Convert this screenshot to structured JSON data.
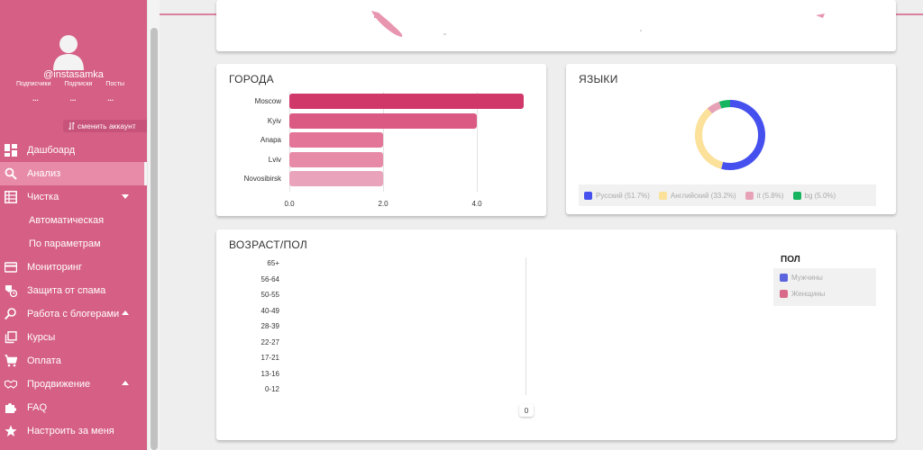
{
  "profile": {
    "username": "@instasamka",
    "stat_labels": [
      "Подписчики",
      "Подписки",
      "Посты"
    ],
    "stat_values": [
      "...",
      "...",
      "..."
    ],
    "switch_account": "сменить аккаунт"
  },
  "nav": [
    {
      "label": "Дашбоард",
      "icon": "dashboard-icon"
    },
    {
      "label": "Анализ",
      "icon": "search-icon",
      "active": true
    },
    {
      "label": "Чистка",
      "icon": "table-icon",
      "caret": "down"
    },
    {
      "label": "Автоматическая",
      "sub": true
    },
    {
      "label": "По параметрам",
      "sub": true
    },
    {
      "label": "Мониторинг",
      "icon": "credit-card-icon"
    },
    {
      "label": "Защита от спама",
      "icon": "clock-shield-icon"
    },
    {
      "label": "Работа с блогерами",
      "icon": "person-search-icon",
      "caret": "up"
    },
    {
      "label": "Курсы",
      "icon": "library-icon"
    },
    {
      "label": "Оплата",
      "icon": "cart-icon"
    },
    {
      "label": "Продвижение",
      "icon": "handshake-icon",
      "caret": "up"
    },
    {
      "label": "FAQ",
      "icon": "puzzle-icon"
    },
    {
      "label": "Настроить за меня",
      "icon": "star-icon"
    }
  ],
  "colors": {
    "sidebar": "#d65f86",
    "bar_primary": "#d0386a",
    "bar_secondary": "#db5a84",
    "bar_tertiary": "#e27598",
    "bar_quaternary": "#e68aa7",
    "bar_quinary": "#e9a3ba",
    "russian": "#4550ee",
    "english": "#fce19a",
    "it": "#e7a2b8",
    "bg": "#17b45f",
    "male": "#5a64dd",
    "female": "#d96b8a"
  },
  "cities": {
    "title": "ГОРОДА",
    "ticks": [
      "0.0",
      "2.0",
      "4.0"
    ]
  },
  "languages": {
    "title": "ЯЗЫКИ"
  },
  "age": {
    "title": "ВОЗРАСТ/ПОЛ",
    "zero": "0",
    "legend_title": "ПОЛ"
  },
  "chart_data": [
    {
      "type": "bar",
      "orientation": "horizontal",
      "title": "ГОРОДА",
      "categories": [
        "Moscow",
        "Kyiv",
        "Anapa",
        "Lviv",
        "Novosibirsk"
      ],
      "values": [
        5,
        4,
        2,
        2,
        2
      ],
      "xlim": [
        0,
        5
      ],
      "x_ticks": [
        "0.0",
        "2.0",
        "4.0"
      ],
      "grid": true
    },
    {
      "type": "pie",
      "donut": true,
      "title": "ЯЗЫКИ",
      "labels": [
        "Русский (51.7%)",
        "Английский (33.2%)",
        "it (5.8%)",
        "bg (5.0%)"
      ],
      "values": [
        51.7,
        33.2,
        5.8,
        5.0
      ],
      "legend": "bottom"
    },
    {
      "type": "bar",
      "orientation": "horizontal",
      "title": "ВОЗРАСТ/ПОЛ",
      "categories": [
        "65+",
        "56-64",
        "50-55",
        "40-49",
        "28-39",
        "22-27",
        "17-21",
        "13-16",
        "0-12"
      ],
      "series": [
        {
          "name": "Мужчины",
          "values": [
            0,
            0,
            0,
            0,
            0,
            0,
            0,
            0,
            0
          ]
        },
        {
          "name": "Женщины",
          "values": [
            0,
            0,
            0,
            0,
            0,
            0,
            0,
            0,
            0
          ]
        }
      ],
      "x_ticks": [
        "0"
      ],
      "legend_title": "ПОЛ",
      "legend": "top-right"
    }
  ]
}
